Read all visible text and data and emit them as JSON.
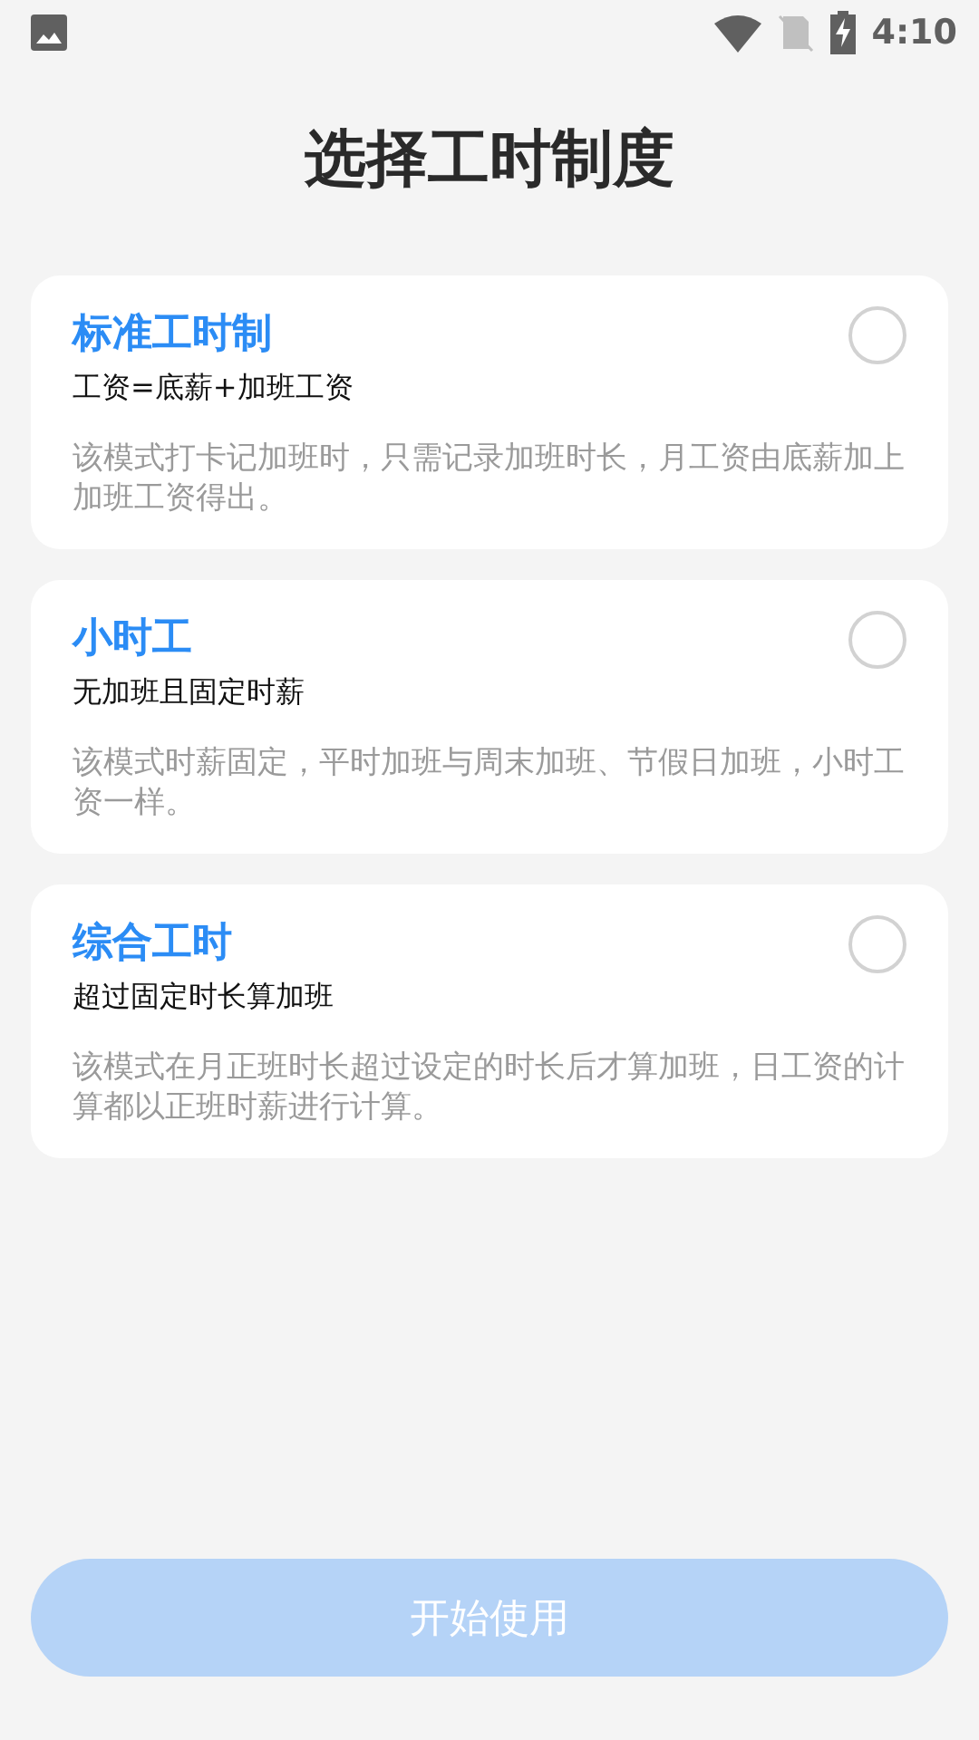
{
  "status_bar": {
    "time": "4:10"
  },
  "title": "选择工时制度",
  "options": [
    {
      "name": "标准工时制",
      "formula": "工资=底薪+加班工资",
      "description": "该模式打卡记加班时，只需记录加班时长，月工资由底薪加上加班工资得出。",
      "selected": false
    },
    {
      "name": "小时工",
      "formula": "无加班且固定时薪",
      "description": "该模式时薪固定，平时加班与周末加班、节假日加班，小时工资一样。",
      "selected": false
    },
    {
      "name": "综合工时",
      "formula": "超过固定时长算加班",
      "description": "该模式在月正班时长超过设定的时长后才算加班，日工资的计算都以正班时薪进行计算。",
      "selected": false
    }
  ],
  "start_button": {
    "label": "开始使用",
    "disabled": true
  }
}
